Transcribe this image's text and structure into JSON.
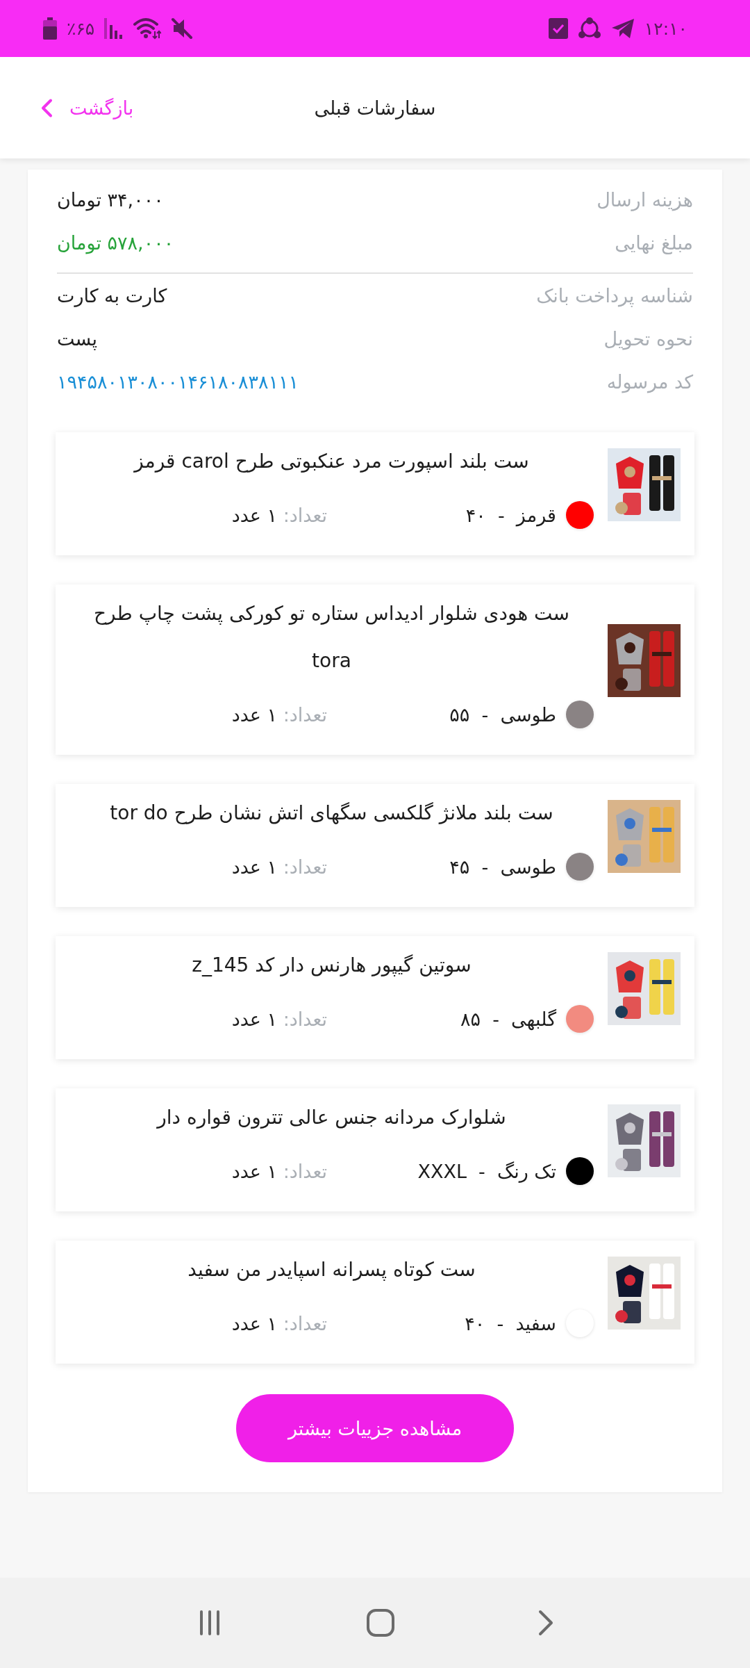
{
  "status_bar": {
    "time": "۱۲:۱۰",
    "battery": "٪۶۵"
  },
  "header": {
    "title": "سفارشات قبلی",
    "back": "بازگشت"
  },
  "summary": [
    {
      "label": "هزینه ارسال",
      "value": "۳۴,۰۰۰ تومان",
      "kind": "text"
    },
    {
      "label": "مبلغ نهایی",
      "value": "۵۷۸,۰۰۰ تومان",
      "kind": "amount"
    }
  ],
  "details": [
    {
      "label": "شناسه پرداخت بانک",
      "value": "کارت به کارت",
      "kind": "text"
    },
    {
      "label": "نحوه تحویل",
      "value": "پست",
      "kind": "text"
    },
    {
      "label": "کد مرسوله",
      "value": "۱۹۴۵۸۰۱۳۰۸۰۰۱۴۶۱۸۰۸۳۸۱۱۱",
      "kind": "link"
    }
  ],
  "items": [
    {
      "title": "ست بلند اسپورت مرد عنکبوتی طرح carol قرمز",
      "variant": "قرمز  -  ۴۰",
      "color": "#ff0000",
      "quantity_label": "تعداد:",
      "quantity": "۱ عدد"
    },
    {
      "title": "ست هودی شلوار ادیداس ستاره تو کورکی پشت چاپ طرح tora",
      "variant": "طوسی  -  ۵۵",
      "color": "#8a8384",
      "quantity_label": "تعداد:",
      "quantity": "۱ عدد"
    },
    {
      "title": "ست بلند ملانژ گلکسی سگهای اتش نشان طرح tor do",
      "variant": "طوسی  -  ۴۵",
      "color": "#8a8384",
      "quantity_label": "تعداد:",
      "quantity": "۱ عدد"
    },
    {
      "title": "سوتین گیپور هارنس دار کد z_145",
      "variant": "گلبهی  -  ۸۵",
      "color": "#f28b80",
      "quantity_label": "تعداد:",
      "quantity": "۱ عدد"
    },
    {
      "title": "شلوارک مردانه جنس عالی تترون قواره دار",
      "variant": "تک رنگ  -  XXXL",
      "color": "#000000",
      "quantity_label": "تعداد:",
      "quantity": "۱ عدد"
    },
    {
      "title": "ست کوتاه پسرانه اسپایدر من سفید",
      "variant": "سفید  -  ۴۰",
      "color": "#ffffff",
      "quantity_label": "تعداد:",
      "quantity": "۱ عدد"
    }
  ],
  "more_button": "مشاهده جزییات بیشتر"
}
